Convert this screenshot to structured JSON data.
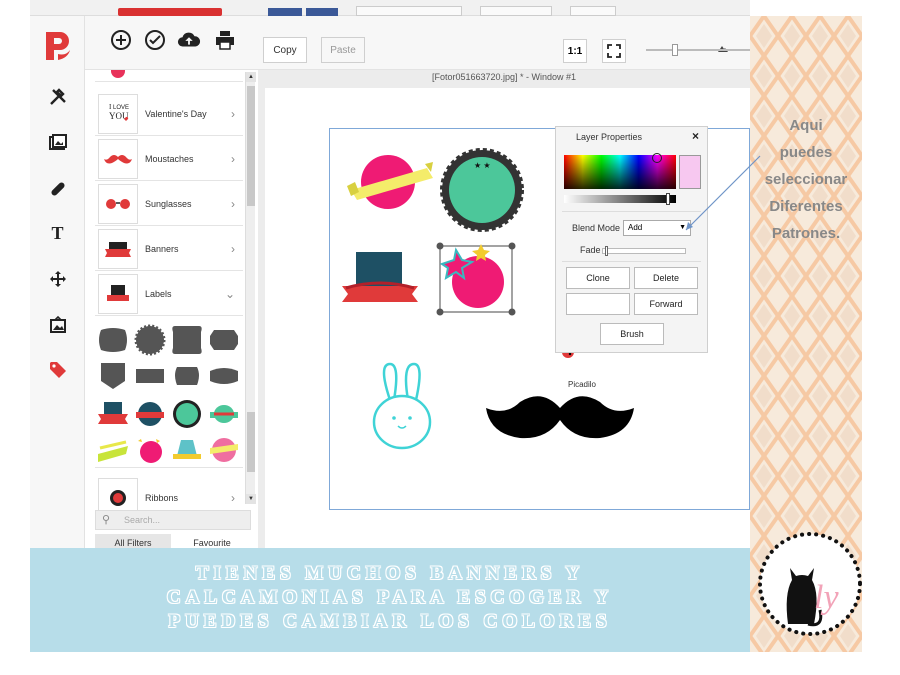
{
  "toolbar": {
    "copy_label": "Copy",
    "paste_label": "Paste",
    "actual_size_label": "1:1"
  },
  "panel": {
    "items": [
      {
        "label": "Valentine's Day",
        "chevron": "›"
      },
      {
        "label": "Moustaches",
        "chevron": "›"
      },
      {
        "label": "Sunglasses",
        "chevron": "›"
      },
      {
        "label": "Banners",
        "chevron": "›"
      },
      {
        "label": "Labels",
        "chevron": "⌄"
      },
      {
        "label": "Ribbons",
        "chevron": "›"
      }
    ],
    "search_placeholder": "Search...",
    "tab_all": "All Filters",
    "tab_fav": "Favourite"
  },
  "window": {
    "title": "[Fotor051663720.jpg] * - Window #1"
  },
  "canvas": {
    "watermark_label": "Picadilo",
    "watermark_letter": "P"
  },
  "layer_properties": {
    "title": "Layer Properties",
    "close": "×",
    "blend_mode_label": "Blend Mode",
    "blend_mode_value": "Add",
    "fade_label": "Fade",
    "clone_label": "Clone",
    "delete_label": "Delete",
    "forward_label": "Forward",
    "brush_label": "Brush",
    "selected_color": "#f7c8f0"
  },
  "note": {
    "line1": "Aqui",
    "line2": "puedes",
    "line3": "seleccionar",
    "line4": "Diferentes",
    "line5": "Patrones."
  },
  "banner": {
    "line1": "TIENES MUCHOS BANNERS Y",
    "line2": "CALCAMONIAS PARA ESCOGER Y",
    "line3": "PUEDES CAMBIAR LOS COLORES"
  },
  "colors": {
    "brand": "#e03a3a",
    "banner_bg": "#b7dde9",
    "pattern_bg": "#f4e3cf"
  }
}
